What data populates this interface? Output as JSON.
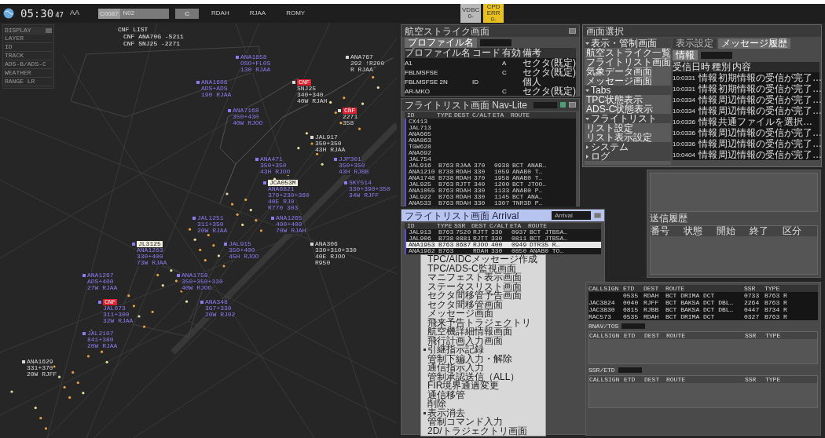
{
  "top_bar": {
    "clock": "05:30",
    "seconds": "47",
    "sector": "AA",
    "command_code": "C0087",
    "command_text": "N02",
    "clear_button": "C",
    "airports": [
      "RDAH",
      "RJAA",
      "ROMY"
    ],
    "indicators": [
      {
        "lines": [
          "VDBC",
          "0-"
        ],
        "color": "#b8b8b8"
      },
      {
        "lines": [
          "CPD",
          "ERR",
          "0-"
        ],
        "color": "#e8c020"
      }
    ]
  },
  "left_menu": {
    "title": "DISPLAY",
    "items": [
      "LAYER",
      "ID",
      "TRACK",
      "ADS-B/ADS-C",
      "WEATHER",
      "RANGE LR"
    ]
  },
  "conflict_list": {
    "title": "CNF LIST",
    "entries": [
      "CNF ANA70G -S211",
      "CNF SNJ25 -2271"
    ]
  },
  "radar": {
    "data_blocks": [
      {
        "lines": [
          "ANA1858",
          "OSO+FL0S",
          "130 RJAA"
        ],
        "color": "#8c7cf0"
      },
      {
        "lines": [
          "ANA767",
          "292 ↑R200",
          "R  RJAA"
        ],
        "color": "#d8d8d8"
      },
      {
        "lines": [
          "ANA1606",
          "ADS+ADS",
          "190 RJAA"
        ],
        "color": "#8c7cf0"
      },
      {
        "alert": "CNF",
        "lines": [
          "SNJ25",
          "340+340",
          "40W RJAH"
        ],
        "color": "#d8d8d8"
      },
      {
        "lines": [
          "ANA7168",
          "350+430",
          "40W RJOO"
        ],
        "color": "#8c7cf0"
      },
      {
        "alert": "CNF",
        "lines": [
          "2271",
          "358"
        ],
        "color": "#d8d8d8"
      },
      {
        "lines": [
          "JAL917",
          "350+350",
          "43H RJAA"
        ],
        "color": "#d8d8d8"
      },
      {
        "lines": [
          "ANA471",
          "350+350",
          "43H RJOO"
        ],
        "color": "#8c7cf0"
      },
      {
        "lines": [
          "JJP301",
          "350+350",
          "43H RJBB"
        ],
        "color": "#8c7cf0"
      },
      {
        "tag": "JCA053M",
        "lines": [
          "ANA6821",
          "370+230+360",
          "40E RJ0",
          "R770 303"
        ],
        "color": "#8c7cf0"
      },
      {
        "lines": [
          "SKY514",
          "330+390+350",
          "34W RJFF"
        ],
        "color": "#8c7cf0"
      },
      {
        "lines": [
          "JAL1251",
          "311+350",
          "20W RJAA"
        ],
        "color": "#8c7cf0"
      },
      {
        "lines": [
          "ANA1265",
          "400+400",
          "70W RJAH"
        ],
        "color": "#8c7cf0"
      },
      {
        "tag": "JL3125",
        "lines": [
          "ANA1263",
          "330+400",
          "73W RJAA"
        ],
        "color": "#8c7cf0"
      },
      {
        "lines": [
          "JAL915",
          "350+400",
          "45H RJOO"
        ],
        "color": "#8c7cf0"
      },
      {
        "lines": [
          "ANA306",
          "330+310+330",
          "40E RJOO",
          "R950"
        ],
        "color": "#d8d8d8"
      },
      {
        "lines": [
          "ANA1267",
          "ADS+400",
          "27W RJAA"
        ],
        "color": "#8c7cf0"
      },
      {
        "lines": [
          "ANA1758",
          "350+350+330",
          "40W RJOO"
        ],
        "color": "#8c7cf0"
      },
      {
        "alert": "CNF",
        "lines": [
          "JAL673",
          "311+300",
          "32W RJAA"
        ],
        "color": "#8c7cf0"
      },
      {
        "lines": [
          "ANA348",
          "3G7+330",
          "20W RJ02"
        ],
        "color": "#8c7cf0"
      },
      {
        "lines": [
          "JAL2107",
          "841+380",
          "20W RJAA"
        ],
        "color": "#8c7cf0"
      },
      {
        "lines": [
          "ANA1629",
          "331+370",
          "20W RJFF"
        ],
        "color": "#d8d8d8"
      }
    ]
  },
  "profile_window": {
    "title": "航空ストライク画面",
    "filter_label": "プロファイル名",
    "columns": [
      "プロファイル名",
      "コード",
      "有効",
      "備考"
    ],
    "rows": [
      [
        "A1",
        "",
        "A",
        "セクタ(既定)"
      ],
      [
        "FBLMSFSE",
        "",
        "C",
        "セクタ(既定)"
      ],
      [
        "FBLMSFSE 2N",
        "ID",
        "",
        "個人"
      ],
      [
        "AR-MKO",
        "",
        "C",
        "セクタ(既定)"
      ]
    ]
  },
  "flight_list": {
    "title": "フライトリスト画面 Nav-Lite",
    "columns": [
      "ID",
      "TYPE",
      "DEST",
      "C/ALT",
      "ETA",
      "ROUTE"
    ],
    "rows": [
      [
        "CX413"
      ],
      [
        "JAL713"
      ],
      [
        "ANA665"
      ],
      [
        "ANA863"
      ],
      [
        "TGW628"
      ],
      [
        "ANA692"
      ],
      [
        "JAL754"
      ],
      [
        "JAL916",
        "B763",
        "RJAA",
        "370",
        "0938",
        "BCT ANAB…"
      ],
      [
        "ANA1210",
        "B738",
        "RDAH",
        "330",
        "1059",
        "ANAB0 T…"
      ],
      [
        "ANA1748",
        "B738",
        "RDAH",
        "370",
        "1958",
        "ANAB0 T…"
      ],
      [
        "JAL925",
        "B763",
        "RJTT",
        "340",
        "1200",
        "BCT JTOO…"
      ],
      [
        "ANA1055",
        "B763",
        "RDAH",
        "330",
        "1133",
        "ANAB0 P…"
      ],
      [
        "JAL922",
        "B763",
        "RDAH",
        "330",
        "1145",
        "BCT ANA…"
      ],
      [
        "ANA533",
        "B763",
        "RDAH",
        "330",
        "1307",
        "TNR3D P…"
      ]
    ]
  },
  "arrival_list": {
    "title": "フライトリスト画面 Arrival",
    "search_label": "Arrival",
    "columns": [
      "ID",
      "TYPE",
      "SSR",
      "DEST",
      "C/ALT",
      "ETA",
      "ROUTE"
    ],
    "rows": [
      {
        "cells": [
          "JAL913",
          "B763",
          "7520",
          "RJTT",
          "330",
          "0937",
          "BCT JTBSA…"
        ],
        "selected": false
      },
      {
        "cells": [
          "JAL906",
          "B738",
          "0881",
          "RJTT",
          "330",
          "0811",
          "BCT JTBSA…"
        ],
        "selected": false
      },
      {
        "cells": [
          "ANA1953",
          "B763",
          "8687",
          "RJOO",
          "400",
          "0949",
          "DTR35 R…"
        ],
        "selected": true
      },
      {
        "cells": [
          "ANA1962",
          "B763",
          "",
          "RDAH",
          "330",
          "0850",
          "ANAB0 TO…"
        ],
        "selected": false
      }
    ]
  },
  "context_menu": {
    "items": [
      {
        "label": "TPC/AIDCメッセージ作成",
        "checked": false
      },
      {
        "label": "TPC/ADS-C監視画面",
        "checked": false
      },
      {
        "label": "マニフェスト表示画面",
        "checked": false
      },
      {
        "label": "ステータスリスト画面",
        "checked": false
      },
      {
        "label": "セクタ間移管予告画面",
        "checked": false
      },
      {
        "label": "セクタ間移管画面",
        "checked": false
      },
      {
        "label": "メッセージ画面",
        "checked": false
      },
      {
        "label": "飛来予告トラジェクトリ",
        "checked": false
      },
      {
        "label": "航空機詳細情報画面",
        "checked": false
      },
      {
        "label": "飛行計画入力画面",
        "checked": false
      },
      {
        "label": "引継指示記録",
        "checked": true
      },
      {
        "label": "管制下編入力・解除",
        "checked": false
      },
      {
        "label": "通信指示入力",
        "checked": false
      },
      {
        "label": "管制承認送信（ALL）",
        "checked": false
      },
      {
        "label": "FIR境界通過変更",
        "checked": false
      },
      {
        "label": "通信移管",
        "checked": false
      },
      {
        "label": "削除",
        "checked": false
      },
      {
        "label": "表示消去",
        "checked": true
      },
      {
        "label": "管制コマンド入力",
        "checked": false
      },
      {
        "label": "2D/トラジェクトリ画面",
        "checked": false
      }
    ]
  },
  "menu_window": {
    "title": "画面選択",
    "tree": [
      {
        "label": "表示・管制画面",
        "expanded": true,
        "children": [
          "航空ストライク一覧",
          "フライトリスト画面",
          "気象データ画面",
          "メッセージ画面"
        ]
      },
      {
        "label": "Tabs",
        "expanded": true,
        "children": [
          "TPC状態表示",
          "ADS-C状態表示"
        ]
      },
      {
        "label": "フライトリスト",
        "expanded": true,
        "children": [
          "リスト設定",
          "リスト表示設定"
        ]
      },
      {
        "label": "システム",
        "expanded": false
      },
      {
        "label": "ログ",
        "expanded": false
      }
    ],
    "tabs": [
      {
        "label": "表示設定",
        "selected": false
      },
      {
        "label": "メッセージ履歴",
        "selected": true
      }
    ],
    "filter_label": "情報",
    "columns": [
      "受信日時",
      "種別",
      "内容"
    ],
    "messages": [
      [
        "10:0331",
        "情報",
        "初期情報の受信が完了…"
      ],
      [
        "10:0331",
        "情報",
        "初期情報の受信が完了…"
      ],
      [
        "10:0334",
        "情報",
        "周辺情報の受信が完了…"
      ],
      [
        "10:0334",
        "情報",
        "周辺情報の受信が完了…"
      ],
      [
        "10:0336",
        "情報",
        "共通ファイルを選択…"
      ],
      [
        "10:0336",
        "情報",
        "周辺情報の受信が完了…"
      ],
      [
        "10:0336",
        "情報",
        "周辺情報の受信が完了…"
      ],
      [
        "10:0404",
        "情報",
        "周辺情報の受信が完了…"
      ]
    ]
  },
  "history_window": {
    "title": "送信履歴",
    "columns": [
      "番号",
      "状態",
      "開始",
      "終了",
      "区分"
    ]
  },
  "departure_window": {
    "columns": [
      "CALLSIGN",
      "ETD",
      "DEST",
      "ROUTE",
      "SSR",
      "TYPE"
    ],
    "rows": [
      [
        "",
        "0535",
        "RDAH",
        "BCT DRIMA DCT",
        "0733",
        "B763 R"
      ],
      [
        "JAC3824",
        "0040",
        "RJFF",
        "BCT BAKSA DCT DBL…",
        "2264",
        "B763 R"
      ],
      [
        "JAC3830",
        "0815",
        "RJBB",
        "BCT BAKSA DCT DBL…",
        "0447",
        "B734 R"
      ],
      [
        "RAC573",
        "0535",
        "RDAH",
        "BCT DRIMA DCT",
        "0327",
        "B763 R"
      ]
    ],
    "sections": [
      {
        "label": "RNAV/TOS",
        "columns": [
          "CALLSIGN",
          "ETD",
          "DEST",
          "ROUTE",
          "SSR",
          "TYPE"
        ]
      },
      {
        "label": "SSR/ETD",
        "columns": [
          "CALLSIGN",
          "ETD",
          "DEST",
          "ROUTE",
          "SSR",
          "TYPE"
        ]
      }
    ]
  }
}
